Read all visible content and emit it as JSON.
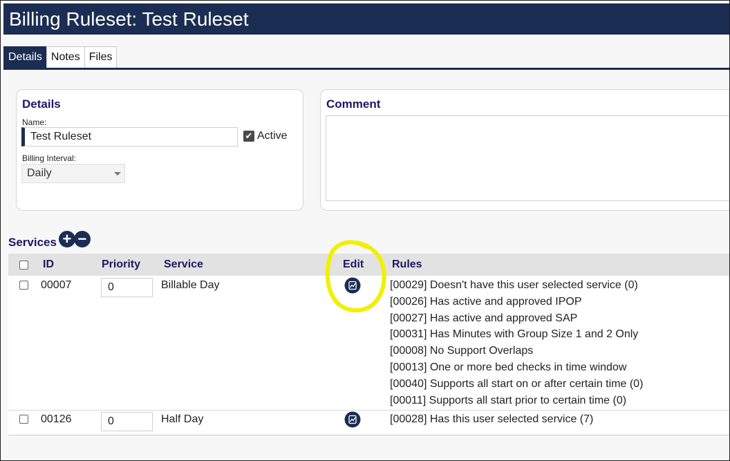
{
  "page": {
    "title": "Billing Ruleset: Test Ruleset"
  },
  "tabs": [
    {
      "label": "Details",
      "active": true
    },
    {
      "label": "Notes",
      "active": false
    },
    {
      "label": "Files",
      "active": false
    }
  ],
  "details": {
    "heading": "Details",
    "name_label": "Name:",
    "name_value": "Test Ruleset",
    "active_label": "Active",
    "active_checked": true,
    "interval_label": "Billing Interval:",
    "interval_value": "Daily"
  },
  "comment": {
    "heading": "Comment",
    "value": ""
  },
  "services": {
    "heading": "Services",
    "add_icon": "plus-circle-icon",
    "remove_icon": "minus-circle-icon",
    "columns": {
      "id": "ID",
      "priority": "Priority",
      "service": "Service",
      "edit": "Edit",
      "rules": "Rules"
    },
    "rows": [
      {
        "id": "00007",
        "priority": "0",
        "service": "Billable Day",
        "rules": [
          "[00029] Doesn't have this user selected service (0)",
          "[00026] Has active and approved IPOP",
          "[00027] Has active and approved SAP",
          "[00031] Has Minutes with Group Size 1 and 2 Only",
          "[00008] No Support Overlaps",
          "[00013] One or more bed checks in time window",
          "[00040] Supports all start on or after certain time (0)",
          "[00011] Supports all start prior to certain time (0)"
        ]
      },
      {
        "id": "00126",
        "priority": "0",
        "service": "Half Day",
        "rules": [
          "[00028] Has this user selected service (7)"
        ]
      }
    ]
  },
  "colors": {
    "header_bg": "#1b2d52",
    "heading_text": "#1e1663",
    "highlight": "#f2ef00"
  }
}
